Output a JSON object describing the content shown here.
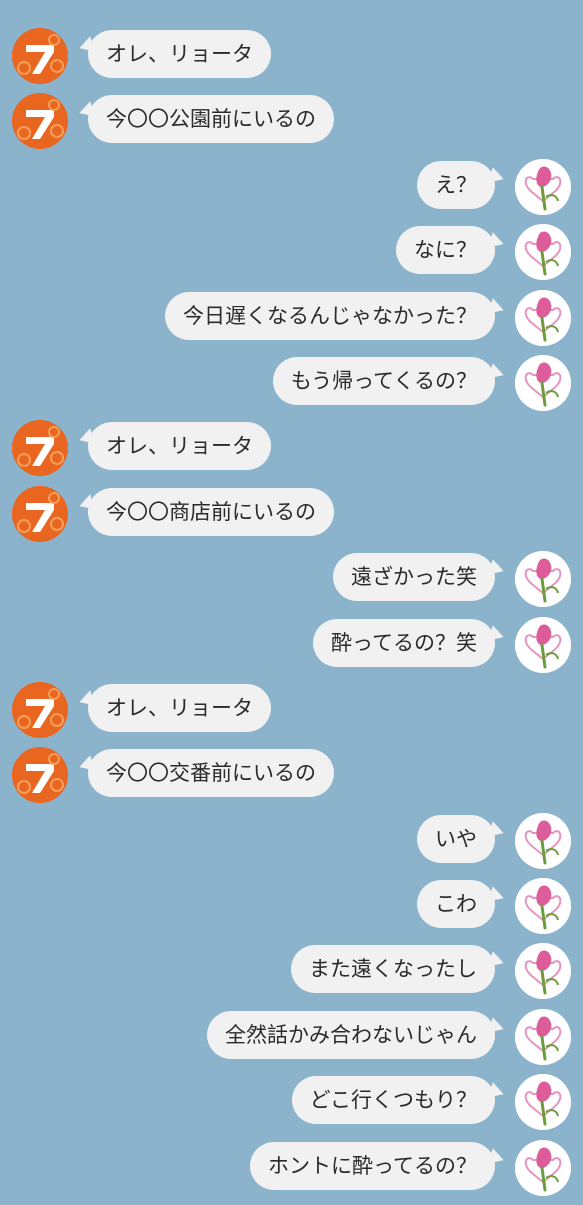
{
  "colors": {
    "background": "#8bb3cb",
    "bubble": "#f1f1f1",
    "avatar_left": "#e8661f",
    "avatar_right": "#ffffff"
  },
  "avatars": {
    "left_icon": "orange-seven-avatar-icon",
    "right_icon": "rose-heart-avatar-icon"
  },
  "messages": [
    {
      "side": "left",
      "text": "オレ、リョータ"
    },
    {
      "side": "left",
      "text": "今〇〇公園前にいるの"
    },
    {
      "side": "right",
      "text": "え？"
    },
    {
      "side": "right",
      "text": "なに？"
    },
    {
      "side": "right",
      "text": "今日遅くなるんじゃなかった？"
    },
    {
      "side": "right",
      "text": "もう帰ってくるの？"
    },
    {
      "side": "left",
      "text": "オレ、リョータ"
    },
    {
      "side": "left",
      "text": "今〇〇商店前にいるの"
    },
    {
      "side": "right",
      "text": "遠ざかった笑"
    },
    {
      "side": "right",
      "text": "酔ってるの？笑"
    },
    {
      "side": "left",
      "text": "オレ、リョータ"
    },
    {
      "side": "left",
      "text": "今〇〇交番前にいるの"
    },
    {
      "side": "right",
      "text": "いや"
    },
    {
      "side": "right",
      "text": "こわ"
    },
    {
      "side": "right",
      "text": "また遠くなったし"
    },
    {
      "side": "right",
      "text": "全然話かみ合わないじゃん"
    },
    {
      "side": "right",
      "text": "どこ行くつもり？"
    },
    {
      "side": "right",
      "text": "ホントに酔ってるの？"
    }
  ]
}
